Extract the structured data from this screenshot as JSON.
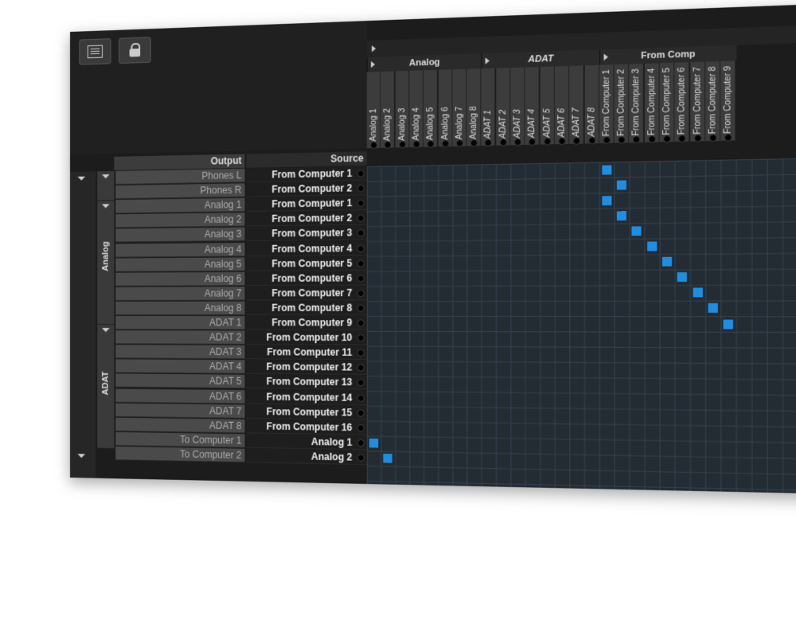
{
  "toolbar": {
    "icons": [
      "mixer-view-icon",
      "lock-icon"
    ]
  },
  "headers": {
    "output": "Output",
    "source": "Source"
  },
  "column_groups": [
    {
      "label": "Analog"
    },
    {
      "label": "ADAT"
    },
    {
      "label": "From Comp"
    }
  ],
  "columns": [
    {
      "label": "Analog 1",
      "italic": false
    },
    {
      "label": "Analog 2",
      "italic": false
    },
    {
      "label": "Analog 3",
      "italic": false
    },
    {
      "label": "Analog 4",
      "italic": false
    },
    {
      "label": "Analog 5",
      "italic": false
    },
    {
      "label": "Analog 6",
      "italic": false
    },
    {
      "label": "Analog 7",
      "italic": false
    },
    {
      "label": "Analog 8",
      "italic": false
    },
    {
      "label": "ADAT 1",
      "italic": true
    },
    {
      "label": "ADAT 2",
      "italic": true
    },
    {
      "label": "ADAT 3",
      "italic": true
    },
    {
      "label": "ADAT 4",
      "italic": true
    },
    {
      "label": "ADAT 5",
      "italic": true
    },
    {
      "label": "ADAT 6",
      "italic": true
    },
    {
      "label": "ADAT 7",
      "italic": true
    },
    {
      "label": "ADAT 8",
      "italic": true
    },
    {
      "label": "From Computer 1",
      "italic": false
    },
    {
      "label": "From Computer 2",
      "italic": false
    },
    {
      "label": "From Computer 3",
      "italic": false
    },
    {
      "label": "From Computer 4",
      "italic": false
    },
    {
      "label": "From Computer 5",
      "italic": false
    },
    {
      "label": "From Computer 6",
      "italic": false
    },
    {
      "label": "From Computer 7",
      "italic": false
    },
    {
      "label": "From Computer 8",
      "italic": false
    },
    {
      "label": "From Computer 9",
      "italic": false
    }
  ],
  "row_groups": [
    {
      "label": ""
    },
    {
      "label": "Analog"
    },
    {
      "label": "ADAT"
    }
  ],
  "rows": [
    {
      "output": "Phones L",
      "source": "From Computer 1"
    },
    {
      "output": "Phones R",
      "source": "From Computer 2"
    },
    {
      "output": "Analog 1",
      "source": "From Computer 1"
    },
    {
      "output": "Analog 2",
      "source": "From Computer 2"
    },
    {
      "output": "Analog 3",
      "source": "From Computer 3"
    },
    {
      "output": "Analog 4",
      "source": "From Computer 4"
    },
    {
      "output": "Analog 5",
      "source": "From Computer 5"
    },
    {
      "output": "Analog 6",
      "source": "From Computer 6"
    },
    {
      "output": "Analog 7",
      "source": "From Computer 7"
    },
    {
      "output": "Analog 8",
      "source": "From Computer 8"
    },
    {
      "output": "ADAT 1",
      "source": "From Computer 9"
    },
    {
      "output": "ADAT 2",
      "source": "From Computer 10"
    },
    {
      "output": "ADAT 3",
      "source": "From Computer 11"
    },
    {
      "output": "ADAT 4",
      "source": "From Computer 12"
    },
    {
      "output": "ADAT 5",
      "source": "From Computer 13"
    },
    {
      "output": "ADAT 6",
      "source": "From Computer 14"
    },
    {
      "output": "ADAT 7",
      "source": "From Computer 15"
    },
    {
      "output": "ADAT 8",
      "source": "From Computer 16"
    },
    {
      "output": "To Computer 1",
      "source": "Analog 1"
    },
    {
      "output": "To Computer 2",
      "source": "Analog 2"
    }
  ],
  "routing": [
    {
      "row": 0,
      "col": 16
    },
    {
      "row": 1,
      "col": 17
    },
    {
      "row": 2,
      "col": 16
    },
    {
      "row": 3,
      "col": 17
    },
    {
      "row": 4,
      "col": 18
    },
    {
      "row": 5,
      "col": 19
    },
    {
      "row": 6,
      "col": 20
    },
    {
      "row": 7,
      "col": 21
    },
    {
      "row": 8,
      "col": 22
    },
    {
      "row": 9,
      "col": 23
    },
    {
      "row": 10,
      "col": 24
    },
    {
      "row": 18,
      "col": 0
    },
    {
      "row": 19,
      "col": 1
    }
  ],
  "colors": {
    "active_cell": "#1f8ee0",
    "grid_bg": "#232b33",
    "grid_line": "#34424f"
  }
}
